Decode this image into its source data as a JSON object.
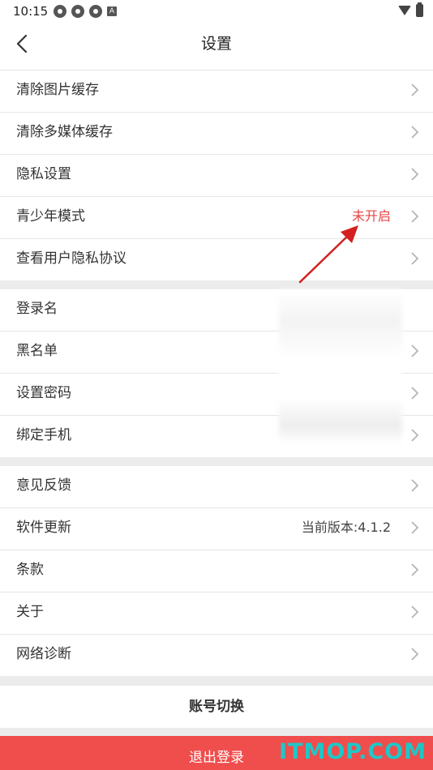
{
  "status_bar": {
    "time": "10:15",
    "notification_icons": [
      "spin-icon",
      "spin-icon",
      "spin-icon",
      "a-icon"
    ],
    "a_icon_text": "A",
    "right_icons": [
      "wifi-icon",
      "battery-icon"
    ]
  },
  "header": {
    "title": "设置",
    "back_icon": "chevron-left-icon"
  },
  "groups": [
    {
      "items": [
        {
          "label": "清除图片缓存",
          "value": ""
        },
        {
          "label": "清除多媒体缓存",
          "value": ""
        },
        {
          "label": "隐私设置",
          "value": ""
        },
        {
          "label": "青少年模式",
          "value": "未开启"
        },
        {
          "label": "查看用户隐私协议",
          "value": ""
        }
      ]
    },
    {
      "items": [
        {
          "label": "登录名",
          "value": ""
        },
        {
          "label": "黑名单",
          "value": ""
        },
        {
          "label": "设置密码",
          "value": ""
        },
        {
          "label": "绑定手机",
          "value": ""
        }
      ]
    },
    {
      "items": [
        {
          "label": "意见反馈",
          "value": ""
        },
        {
          "label": "软件更新",
          "value": "当前版本:4.1.2"
        },
        {
          "label": "条款",
          "value": ""
        },
        {
          "label": "关于",
          "value": ""
        },
        {
          "label": "网络诊断",
          "value": ""
        }
      ]
    }
  ],
  "actions": {
    "switch_account": "账号切换",
    "logout": "退出登录"
  },
  "watermark": "ITMOP.COM",
  "colors": {
    "accent_red": "#f04d4d",
    "status_red": "#e84545",
    "watermark_teal": "#1fc7c7",
    "annotation_arrow": "#d42020"
  }
}
